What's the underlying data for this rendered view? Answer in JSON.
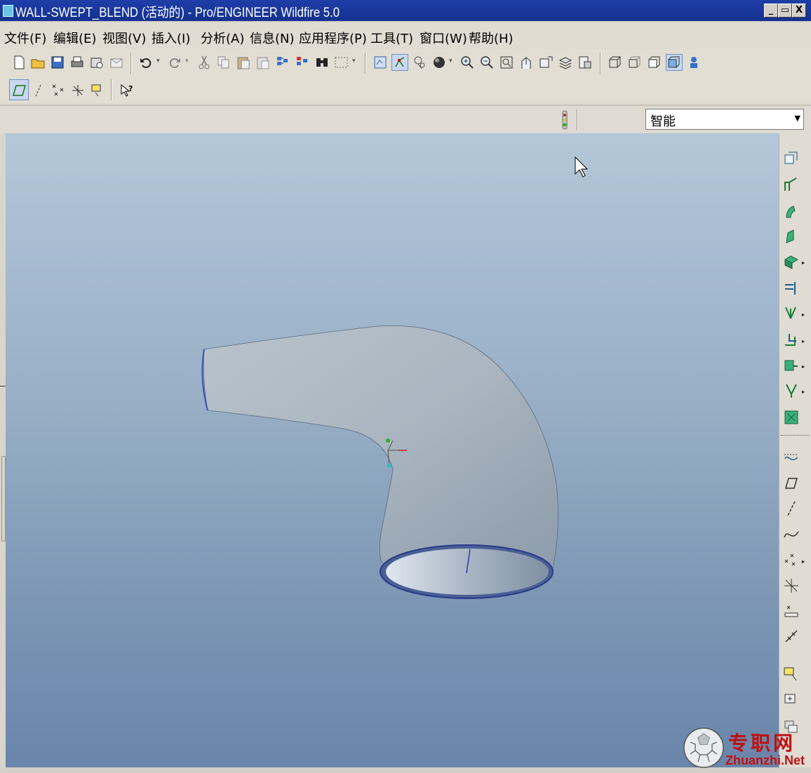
{
  "window": {
    "title": "WALL-SWEPT_BLEND (活动的) - Pro/ENGINEER Wildfire 5.0",
    "controls": [
      "_",
      "▭",
      "X"
    ]
  },
  "menu": [
    "文件(F)",
    "编辑(E)",
    "视图(V)",
    "插入(I)",
    "分析(A)",
    "信息(N)",
    "应用程序(P)",
    "工具(T)",
    "窗口(W)",
    "帮助(H)"
  ],
  "toolbar_main": {
    "icons": [
      "new-icon",
      "open-icon",
      "save-icon",
      "print-icon",
      "send-icon",
      "mail-icon",
      "undo-icon",
      "redo-icon",
      "cut-icon",
      "copy-icon",
      "paste-icon",
      "paste-special-icon",
      "regenerate-icon",
      "regen-manager-icon",
      "find-icon",
      "select-box-icon",
      "repaint-icon",
      "spin-center-icon",
      "orient-mode-icon",
      "shading-icon",
      "zoom-in-icon",
      "zoom-out-icon",
      "refit-icon",
      "reorient-icon",
      "saved-views-icon",
      "layers-icon",
      "view-manager-icon",
      "wireframe-icon",
      "hidden-line-icon",
      "no-hidden-icon",
      "shaded-icon",
      "model-tree-icon"
    ]
  },
  "toolbar_datum": {
    "icons": [
      "datum-plane-display-icon",
      "datum-axis-display-icon",
      "datum-point-display-icon",
      "csys-display-icon",
      "annotation-display-icon",
      "context-help-icon"
    ]
  },
  "filter": {
    "value": "智能"
  },
  "right_toolbar": {
    "icons": [
      "hole-icon",
      "round-icon",
      "shell-icon",
      "draft-icon",
      "rib-icon",
      "mirror-icon",
      "merge-icon",
      "trim-icon",
      "offset-icon",
      "thicken-icon",
      "solidify-icon",
      "sketch-icon",
      "datum-plane-icon",
      "datum-axis-icon",
      "datum-curve-icon",
      "datum-point-icon",
      "csys-icon",
      "analysis-icon",
      "style-icon",
      "annotation-icon",
      "intent-icon",
      "copy-geometry-icon"
    ]
  },
  "watermark": {
    "cn": "专职网",
    "en": "Zhuanzhi.Net"
  },
  "colors": {
    "titlebar": "#14318f",
    "viewport_top": "#b3c7d8",
    "viewport_bottom": "#6985aa",
    "model": "#a9b5c0"
  }
}
